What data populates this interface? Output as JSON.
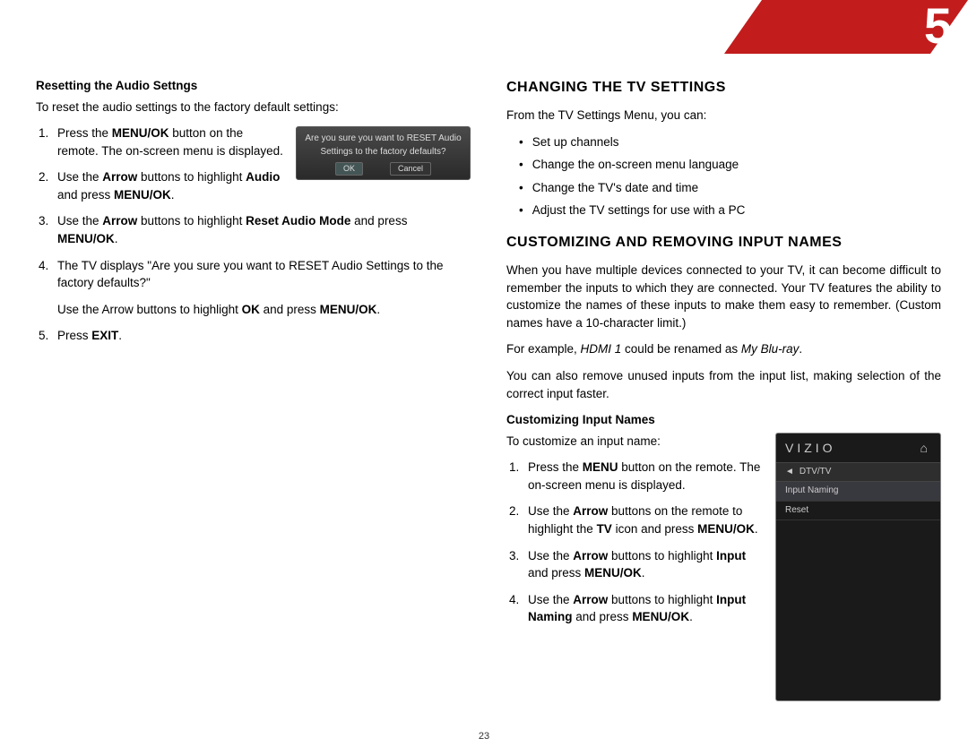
{
  "chapter_number": "5",
  "page_number": "23",
  "left": {
    "heading": "Resetting the Audio Settngs",
    "intro": "To reset the audio settings to the factory default settings:",
    "dialog": {
      "line1": "Are you sure you want to RESET Audio",
      "line2": "Settings to the factory defaults?",
      "ok": "OK",
      "cancel": "Cancel"
    },
    "step1_a": "Press the ",
    "step1_b": "MENU/OK",
    "step1_c": " button on the remote. The on-screen menu is displayed.",
    "step2_a": "Use the ",
    "step2_b": "Arrow",
    "step2_c": " buttons to highlight ",
    "step2_d": "Audio",
    "step2_e": " and press ",
    "step2_f": "MENU/OK",
    "step2_g": ".",
    "step3_a": "Use the ",
    "step3_b": "Arrow",
    "step3_c": " buttons to highlight ",
    "step3_d": "Reset Audio Mode",
    "step3_e": " and press ",
    "step3_f": "MENU/OK",
    "step3_g": ".",
    "step4_a": "The TV displays \"Are you sure you want to RESET Audio Settings to the factory defaults?\"",
    "step4_b1": "Use the Arrow buttons to highlight ",
    "step4_b2": "OK",
    "step4_b3": " and press ",
    "step4_b4": "MENU/OK",
    "step4_b5": ".",
    "step5_a": "Press ",
    "step5_b": "EXIT",
    "step5_c": "."
  },
  "right": {
    "sec1_title": "CHANGING THE TV SETTINGS",
    "sec1_intro": "From the TV Settings Menu, you can:",
    "sec1_items": {
      "a": "Set up channels",
      "b": "Change the on-screen menu language",
      "c": "Change the TV's date and time",
      "d": "Adjust the TV settings for use with a PC"
    },
    "sec2_title": "CUSTOMIZING AND REMOVING INPUT NAMES",
    "sec2_p1": "When you have multiple devices connected to your TV, it can become difficult to remember the inputs to which they are connected. Your TV features the ability to customize the names of these inputs to make them easy to remember. (Custom names have a 10-character limit.)",
    "sec2_p2_a": "For example, ",
    "sec2_p2_b": "HDMI 1",
    "sec2_p2_c": " could be renamed as ",
    "sec2_p2_d": "My Blu-ray",
    "sec2_p2_e": ".",
    "sec2_p3": "You can also remove unused inputs from the input list, making selection of the correct input faster.",
    "sub_title": "Customizing Input Names",
    "sub_intro": "To customize an input name:",
    "vizio": {
      "brand": "VIZIO",
      "home_icon": "⌂",
      "arrow_icon": "◄",
      "tab": "DTV/TV",
      "row1": "Input Naming",
      "row2": "Reset"
    },
    "s1_a": "Press the ",
    "s1_b": "MENU",
    "s1_c": " button on the remote. The on-screen menu is displayed.",
    "s2_a": "Use the ",
    "s2_b": "Arrow",
    "s2_c": " buttons on the remote to highlight the ",
    "s2_d": "TV",
    "s2_e": " icon and press ",
    "s2_f": "MENU/OK",
    "s2_g": ".",
    "s3_a": "Use the ",
    "s3_b": "Arrow",
    "s3_c": " buttons to highlight ",
    "s3_d": "Input",
    "s3_e": " and press ",
    "s3_f": "MENU/OK",
    "s3_g": ".",
    "s4_a": "Use the ",
    "s4_b": "Arrow",
    "s4_c": " buttons to highlight ",
    "s4_d": "Input Naming",
    "s4_e": " and press ",
    "s4_f": "MENU/OK",
    "s4_g": "."
  }
}
